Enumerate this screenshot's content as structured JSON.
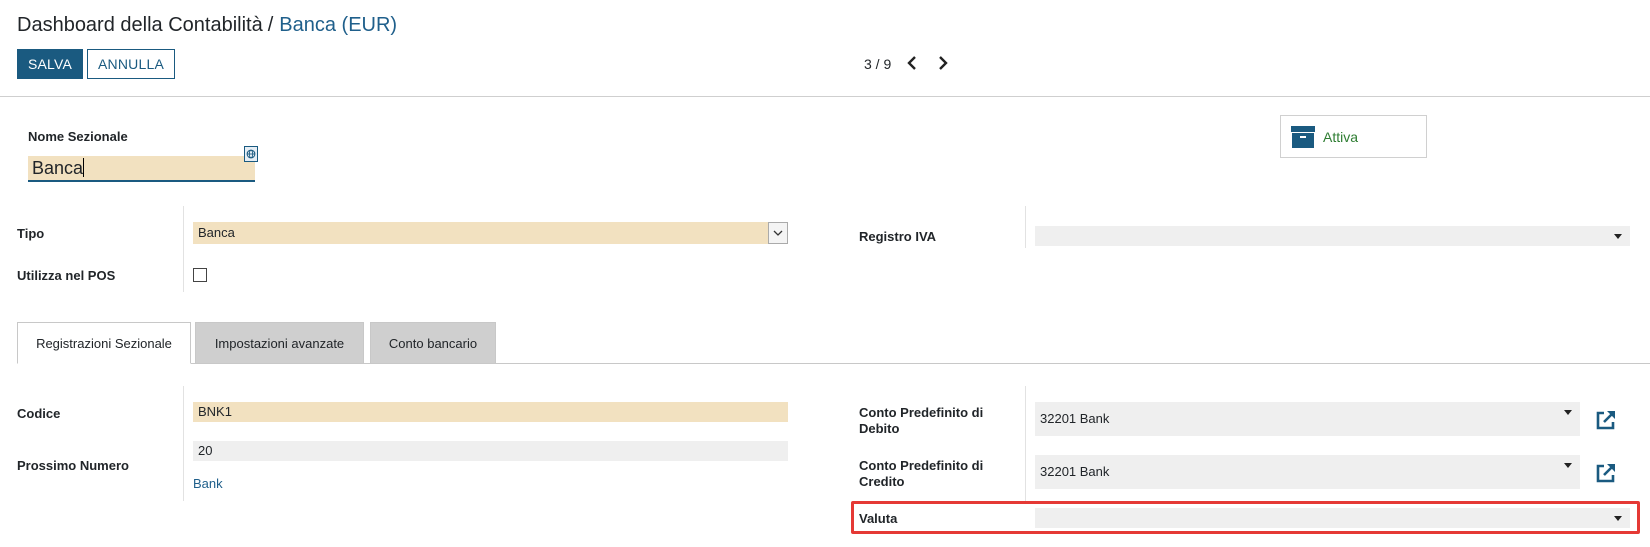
{
  "breadcrumb": {
    "parent": "Dashboard della Contabilità",
    "separator": "/",
    "current": "Banca (EUR)"
  },
  "toolbar": {
    "save_label": "SALVA",
    "cancel_label": "ANNULLA"
  },
  "pager": {
    "text": "3 / 9"
  },
  "header": {
    "name_label": "Nome Sezionale",
    "name_value": "Banca",
    "active_button_label": "Attiva"
  },
  "fields": {
    "tipo_label": "Tipo",
    "tipo_value": "Banca",
    "pos_label": "Utilizza nel POS",
    "registro_iva_label": "Registro IVA",
    "registro_iva_value": ""
  },
  "tabs": [
    {
      "label": "Registrazioni Sezionale",
      "active": true
    },
    {
      "label": "Impostazioni avanzate",
      "active": false
    },
    {
      "label": "Conto bancario",
      "active": false
    }
  ],
  "journal": {
    "codice_label": "Codice",
    "codice_value": "BNK1",
    "prossimo_label": "Prossimo Numero",
    "prossimo_value": "20",
    "prossimo_link": "Bank",
    "debito_label": "Conto Predefinito di Debito",
    "debito_value": "32201 Bank",
    "credito_label": "Conto Predefinito di Credito",
    "credito_value": "32201 Bank",
    "valuta_label": "Valuta",
    "valuta_value": ""
  },
  "colors": {
    "primary": "#1a5a80",
    "required_bg": "#f2e1c0",
    "highlight": "#e53935",
    "active_green": "#2e7d32"
  },
  "icons": [
    "chevron-left-icon",
    "chevron-right-icon",
    "globe-icon",
    "archive-icon",
    "external-link-icon",
    "dropdown-caret-icon"
  ]
}
